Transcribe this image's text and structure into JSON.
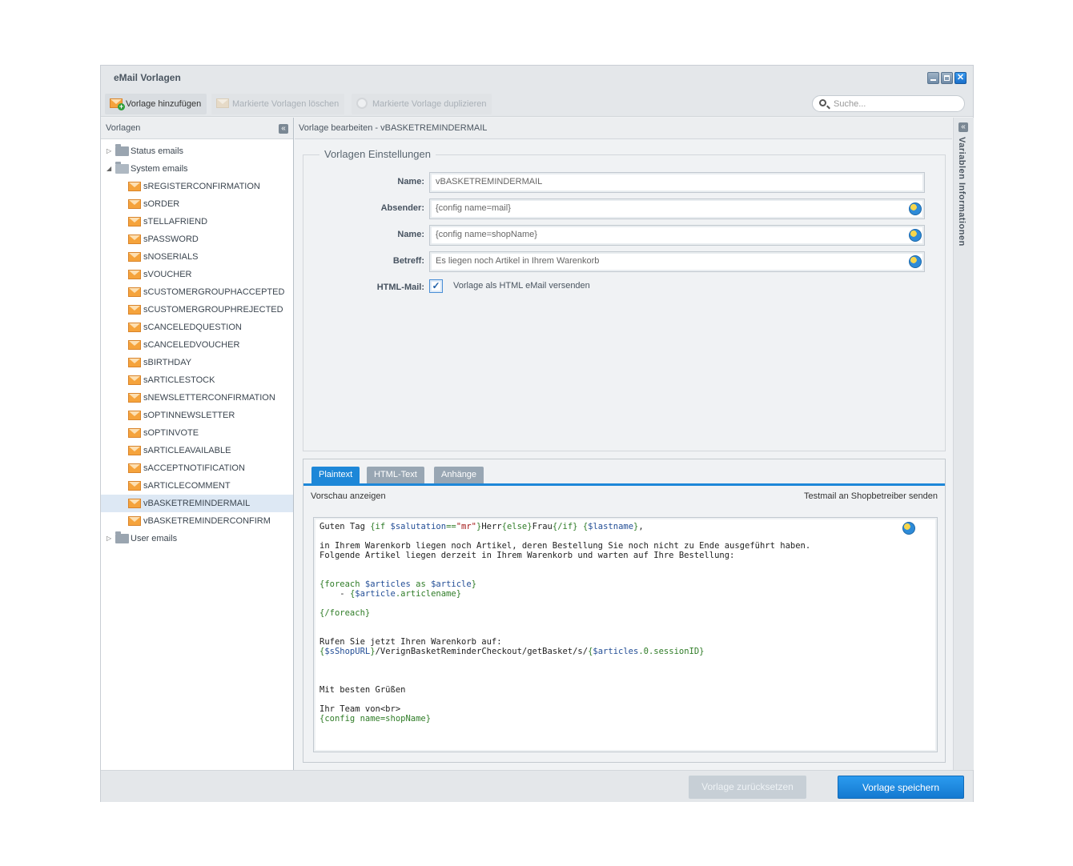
{
  "window": {
    "title": "eMail Vorlagen"
  },
  "toolbar": {
    "add_label": "Vorlage hinzufügen",
    "delete_label": "Markierte Vorlagen löschen",
    "duplicate_label": "Markierte Vorlage duplizieren",
    "search_placeholder": "Suche..."
  },
  "left_panel": {
    "title": "Vorlagen",
    "tree": {
      "status_folder": "Status emails",
      "system_folder": "System emails",
      "system_items": [
        "sREGISTERCONFIRMATION",
        "sORDER",
        "sTELLAFRIEND",
        "sPASSWORD",
        "sNOSERIALS",
        "sVOUCHER",
        "sCUSTOMERGROUPHACCEPTED",
        "sCUSTOMERGROUPHREJECTED",
        "sCANCELEDQUESTION",
        "sCANCELEDVOUCHER",
        "sBIRTHDAY",
        "sARTICLESTOCK",
        "sNEWSLETTERCONFIRMATION",
        "sOPTINNEWSLETTER",
        "sOPTINVOTE",
        "sARTICLEAVAILABLE",
        "sACCEPTNOTIFICATION",
        "sARTICLECOMMENT",
        "vBASKETREMINDERMAIL",
        "vBASKETREMINDERCONFIRM"
      ],
      "selected": "vBASKETREMINDERMAIL",
      "user_folder": "User emails"
    }
  },
  "main": {
    "header": "Vorlage bearbeiten - vBASKETREMINDERMAIL",
    "settings": {
      "legend": "Vorlagen Einstellungen",
      "name_label": "Name:",
      "name_value": "vBASKETREMINDERMAIL",
      "sender_label": "Absender:",
      "sender_value": "{config name=mail}",
      "sender_name_label": "Name:",
      "sender_name_value": "{config name=shopName}",
      "subject_label": "Betreff:",
      "subject_value": "Es liegen noch Artikel in Ihrem Warenkorb",
      "html_label": "HTML-Mail:",
      "html_checked": true,
      "html_checkbox_label": "Vorlage als HTML eMail versenden"
    },
    "tabs": [
      {
        "label": "Plaintext",
        "active": true
      },
      {
        "label": "HTML-Text",
        "active": false
      },
      {
        "label": "Anhänge",
        "active": false
      }
    ],
    "preview_label": "Vorschau anzeigen",
    "testmail_label": "Testmail an Shopbetreiber senden",
    "code_lines": [
      "Guten Tag {if $salutation==\"mr\"}Herr{else}Frau{/if} {$lastname},",
      "",
      "in Ihrem Warenkorb liegen noch Artikel, deren Bestellung Sie noch nicht zu Ende ausgeführt haben.",
      "Folgende Artikel liegen derzeit in Ihrem Warenkorb und warten auf Ihre Bestellung:",
      "",
      "",
      "{foreach $articles as $article}",
      "    - {$article.articlename}",
      "",
      "{/foreach}",
      "",
      "",
      "Rufen Sie jetzt Ihren Warenkorb auf:",
      "{$sShopURL}/VerignBasketReminderCheckout/getBasket/s/{$articles.0.sessionID}",
      "",
      "",
      "",
      "Mit besten Grüßen",
      "",
      "Ihr Team von<br>",
      "{config name=shopName}"
    ]
  },
  "right_strip": {
    "label": "Variablen Informationen"
  },
  "footer": {
    "reset_label": "Vorlage zurücksetzen",
    "save_label": "Vorlage speichern"
  },
  "colors": {
    "accent": "#1d87d8",
    "selected_row": "#dde8f4"
  }
}
